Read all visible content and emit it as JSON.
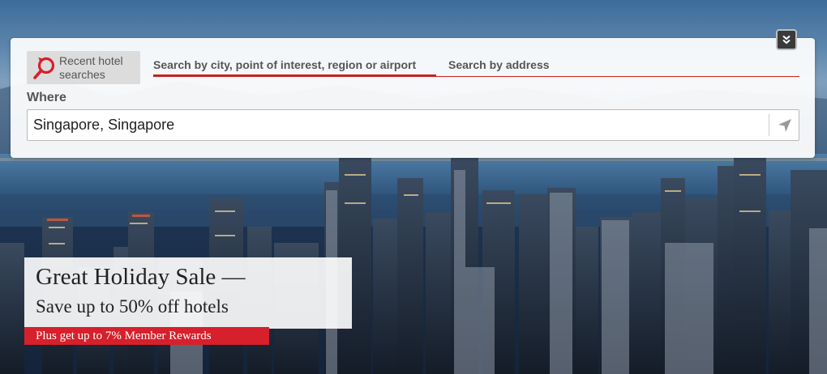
{
  "search": {
    "recent_label": "Recent hotel searches",
    "tabs": [
      {
        "label": "Search by city, point of interest, region or airport",
        "active": true
      },
      {
        "label": "Search by address",
        "active": false
      }
    ],
    "where_label": "Where",
    "where_value": "Singapore, Singapore"
  },
  "promo": {
    "title": "Great Holiday Sale —",
    "subtitle": "Save up to 50% off hotels",
    "rewards": "Plus get up to 7% Member Rewards"
  },
  "icons": {
    "recent": "search-history-icon",
    "collapse": "double-chevron-down-icon",
    "locate": "location-arrow-icon"
  },
  "colors": {
    "accent": "#c8201e",
    "rewards_bg": "#d6202b"
  }
}
